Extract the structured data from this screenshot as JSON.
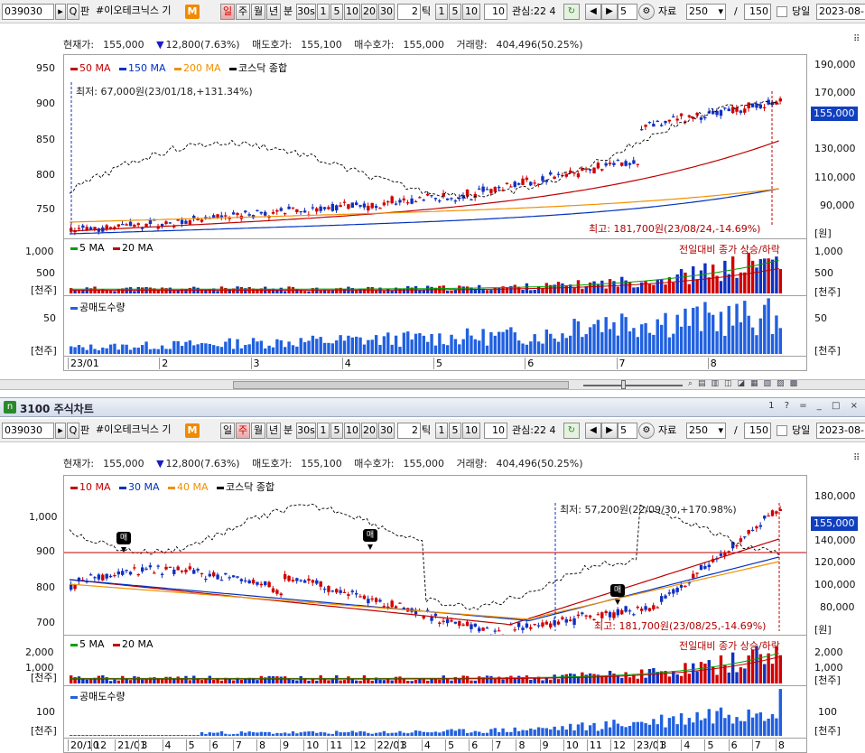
{
  "top": {
    "toolbar": {
      "code": "039030",
      "name": "#이오테크닉스 기",
      "m_badge": "M",
      "search_glyph": "Q",
      "pan_label": "판",
      "period_buttons": [
        "일",
        "주",
        "월",
        "년",
        "분",
        "30s",
        "1",
        "5",
        "10",
        "20",
        "30"
      ],
      "active_period": "일",
      "tick_value": "2",
      "tick_label": "틱",
      "tick_buttons": [
        "1",
        "5",
        "10"
      ],
      "tick_input": "10",
      "interest": "관심:22 4",
      "step_value": "5",
      "data_label": "자료",
      "data_count": "250",
      "slash": "/",
      "total": "150",
      "same_day_label": "당일",
      "date": "2023-08-"
    },
    "info": {
      "current_price_label": "현재가:",
      "current_price": "155,000",
      "change_arrow": "▼",
      "change": "12,800(7.63%)",
      "ask_label": "매도호가:",
      "ask": "155,100",
      "bid_label": "매수호가:",
      "bid": "155,000",
      "volume_label": "거래량:",
      "volume": "404,496(50.25%)"
    },
    "legend": [
      {
        "label": "50 MA",
        "color": "#c00000"
      },
      {
        "label": "150 MA",
        "color": "#0030c0"
      },
      {
        "label": "200 MA",
        "color": "#f09000"
      },
      {
        "label": "코스닥 종합",
        "color": "#000000"
      }
    ],
    "left_axis": [
      "950",
      "900",
      "850",
      "800",
      "750"
    ],
    "right_axis": [
      "190,000",
      "170,000",
      "150,000",
      "130,000",
      "110,000",
      "90,000"
    ],
    "right_unit": "[원]",
    "price_badge": "155,000",
    "low_annotation": "최저: 67,000원(23/01/18,+131.34%)",
    "high_annotation": "최고: 181,700원(23/08/24,-14.69%)",
    "volume_legend": [
      {
        "label": "5 MA",
        "color": "#00a000"
      },
      {
        "label": "20 MA",
        "color": "#c00000"
      }
    ],
    "volume_annotation": "전일대비 종가 상승/하락",
    "volume_left_axis": [
      "1,000",
      "500",
      "[천주]"
    ],
    "volume_right_axis": [
      "1,000",
      "500",
      "[천주]"
    ],
    "short_legend": "공매도수량",
    "short_left_axis": [
      "50",
      "[천주]"
    ],
    "short_right_axis": [
      "50",
      "[천주]"
    ],
    "x_axis": [
      "23/01",
      "2",
      "3",
      "4",
      "5",
      "6",
      "7",
      "8"
    ]
  },
  "bottom": {
    "title": "3100 주식차트",
    "title_icon": "n",
    "title_buttons": [
      "1",
      "?",
      "=",
      "_",
      "□",
      "×"
    ],
    "toolbar": {
      "code": "039030",
      "name": "#이오테크닉스 기",
      "m_badge": "M",
      "search_glyph": "Q",
      "pan_label": "판",
      "period_buttons": [
        "일",
        "주",
        "월",
        "년",
        "분",
        "30s",
        "1",
        "5",
        "10",
        "20",
        "30"
      ],
      "active_period": "주",
      "tick_value": "2",
      "tick_label": "틱",
      "tick_buttons": [
        "1",
        "5",
        "10"
      ],
      "tick_input": "10",
      "interest": "관심:22 4",
      "step_value": "5",
      "data_label": "자료",
      "data_count": "250",
      "slash": "/",
      "total": "150",
      "same_day_label": "당일",
      "date": "2023-08-"
    },
    "info": {
      "current_price_label": "현재가:",
      "current_price": "155,000",
      "change_arrow": "▼",
      "change": "12,800(7.63%)",
      "ask_label": "매도호가:",
      "ask": "155,100",
      "bid_label": "매수호가:",
      "bid": "155,000",
      "volume_label": "거래량:",
      "volume": "404,496(50.25%)"
    },
    "legend": [
      {
        "label": "10 MA",
        "color": "#c00000"
      },
      {
        "label": "30 MA",
        "color": "#0030c0"
      },
      {
        "label": "40 MA",
        "color": "#f09000"
      },
      {
        "label": "코스닥 종합",
        "color": "#000000"
      }
    ],
    "left_axis": [
      "1,000",
      "900",
      "800",
      "700"
    ],
    "right_axis": [
      "180,000",
      "140,000",
      "120,000",
      "100,000",
      "80,000"
    ],
    "right_unit": "[원]",
    "price_badge": "155,000",
    "low_annotation": "최저: 57,200원(22/09/30,+170.98%)",
    "high_annotation": "최고: 181,700원(23/08/25,-14.69%)",
    "sell_flag": "매",
    "volume_legend": [
      {
        "label": "5 MA",
        "color": "#00a000"
      },
      {
        "label": "20 MA",
        "color": "#c00000"
      }
    ],
    "volume_annotation": "전일대비 종가 상승/하락",
    "volume_left_axis": [
      "2,000",
      "1,000",
      "[천주]"
    ],
    "volume_right_axis": [
      "2,000",
      "1,000",
      "[천주]"
    ],
    "short_legend": "공매도수량",
    "short_left_axis": [
      "100",
      "[천주]"
    ],
    "short_right_axis": [
      "100",
      "[천주]"
    ],
    "x_axis": [
      "20/10",
      "12",
      "21/01",
      "3",
      "4",
      "5",
      "6",
      "7",
      "8",
      "9",
      "10",
      "11",
      "12",
      "22/01",
      "3",
      "4",
      "5",
      "6",
      "7",
      "8",
      "9",
      "10",
      "11",
      "12",
      "23/01",
      "3",
      "4",
      "5",
      "6",
      "7",
      "8"
    ]
  }
}
